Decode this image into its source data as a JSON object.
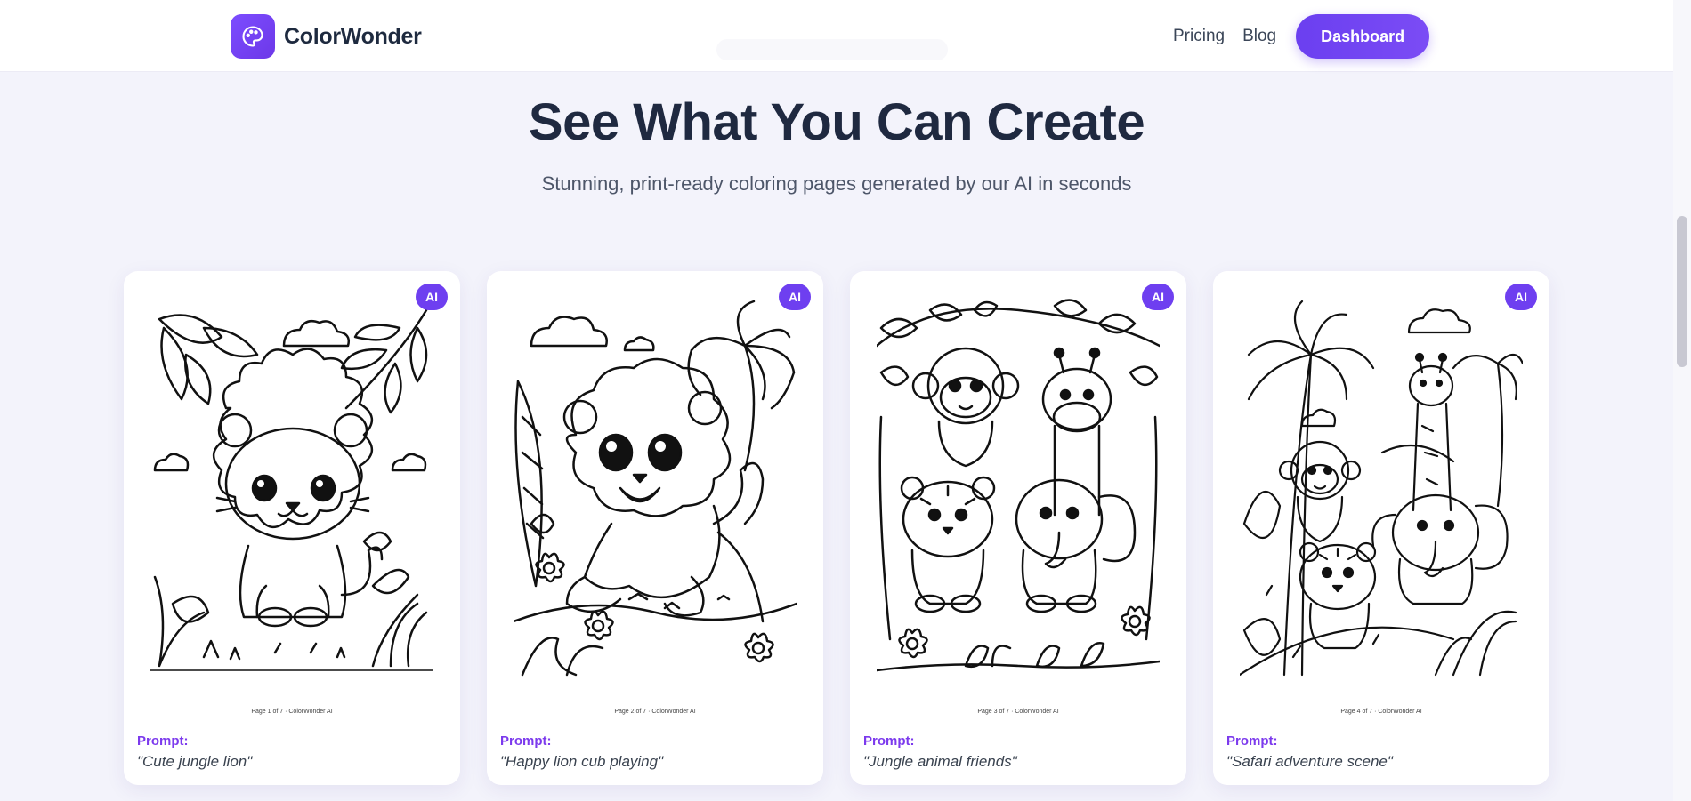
{
  "header": {
    "brand_name": "ColorWonder",
    "nav": {
      "pricing": "Pricing",
      "blog": "Blog",
      "dashboard": "Dashboard"
    }
  },
  "hero": {
    "title": "See What You Can Create",
    "subtitle": "Stunning, print-ready coloring pages generated by our AI in seconds"
  },
  "gallery": {
    "cards": [
      {
        "badge": "AI",
        "caption": "Page 1 of 7 · ColorWonder AI",
        "prompt_label": "Prompt:",
        "prompt": "\"Cute jungle lion\""
      },
      {
        "badge": "AI",
        "caption": "Page 2 of 7 · ColorWonder AI",
        "prompt_label": "Prompt:",
        "prompt": "\"Happy lion cub playing\""
      },
      {
        "badge": "AI",
        "caption": "Page 3 of 7 · ColorWonder AI",
        "prompt_label": "Prompt:",
        "prompt": "\"Jungle animal friends\""
      },
      {
        "badge": "AI",
        "caption": "Page 4 of 7 · ColorWonder AI",
        "prompt_label": "Prompt:",
        "prompt": "\"Safari adventure scene\""
      }
    ]
  },
  "colors": {
    "accent": "#6e3ff0",
    "prompt_label": "#7c3aed",
    "heading": "#1f2940",
    "background": "#f3f3fb"
  },
  "icons": {
    "brand": "palette-icon"
  }
}
